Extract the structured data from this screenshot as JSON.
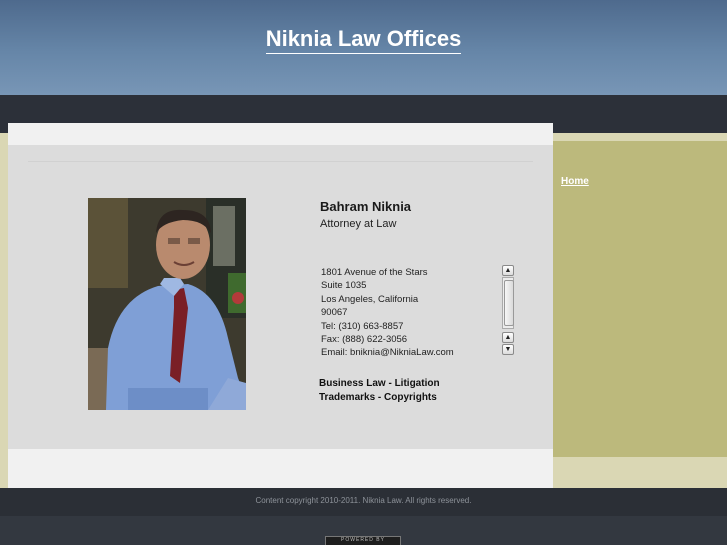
{
  "header": {
    "site_title": "Niknia Law Offices"
  },
  "nav": {
    "items": [
      {
        "label": "Home"
      }
    ]
  },
  "profile": {
    "name": "Bahram Niknia",
    "title": "Attorney at Law",
    "address_lines": [
      "1801 Avenue of the Stars",
      "Suite 1035",
      "Los Angeles, California",
      "90067",
      "Tel: (310) 663-8857",
      "Fax: (888) 622-3056",
      "Email: bniknia@NikniaLaw.com"
    ],
    "practice_lines": [
      "Business Law - Litigation",
      "Trademarks - Copyrights"
    ]
  },
  "footer": {
    "copyright": "Content copyright 2010-2011. Niknia Law. All rights reserved.",
    "badge": "POWERED BY"
  }
}
